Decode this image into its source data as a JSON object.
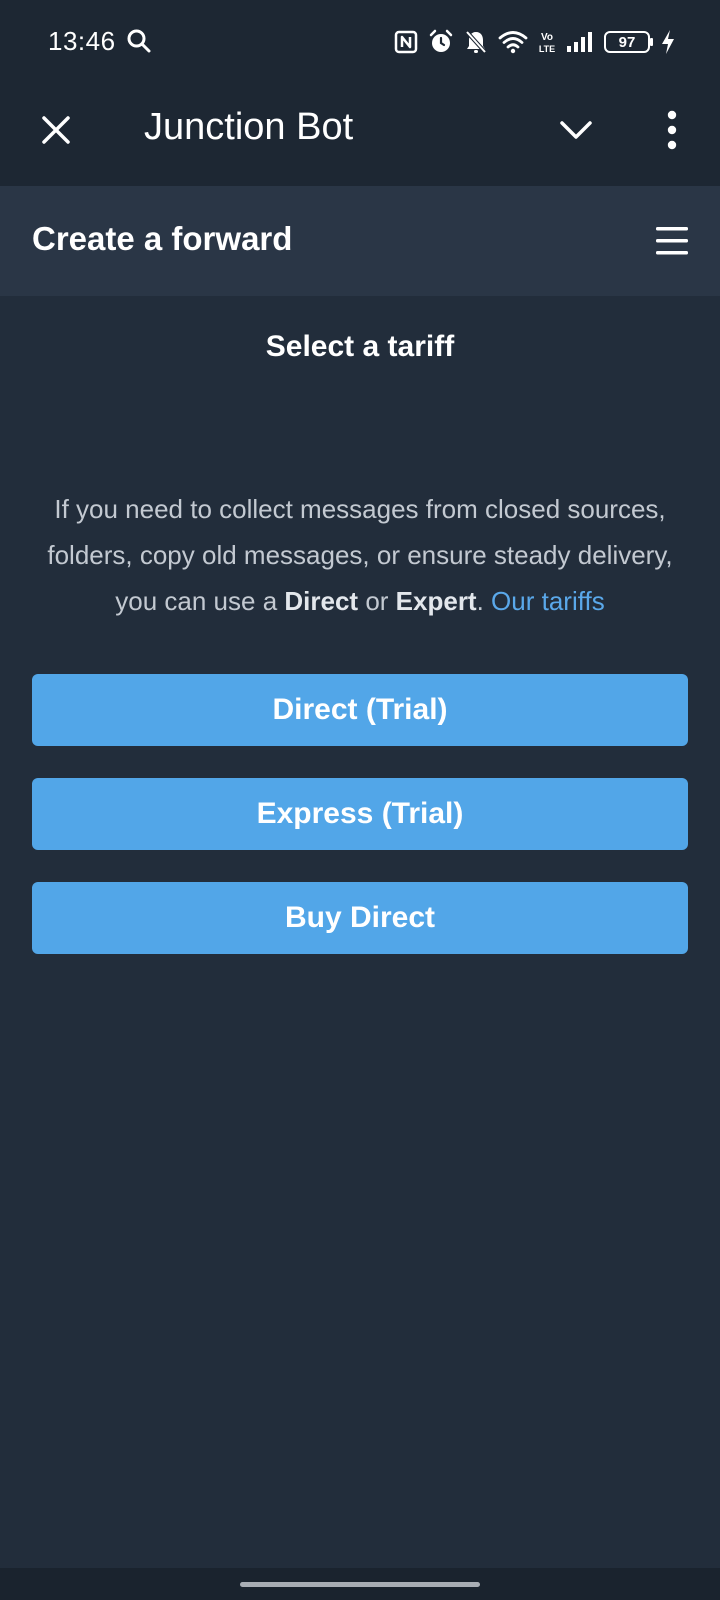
{
  "status_bar": {
    "time": "13:46",
    "battery_level": "97",
    "icons": [
      "search-icon",
      "nfc-icon",
      "alarm-icon",
      "bell-off-icon",
      "wifi-icon",
      "volte-icon",
      "signal-icon",
      "battery-icon",
      "charging-icon"
    ],
    "volte_label": "Vo LTE"
  },
  "app_bar": {
    "title": "Junction Bot"
  },
  "web_header": {
    "title": "Create a forward"
  },
  "main": {
    "section_title": "Select a tariff",
    "description": {
      "part1": "If you need to collect messages from closed sources, folders, copy old messages, or ensure steady delivery, you can use a ",
      "bold1": "Direct",
      "part2": " or ",
      "bold2": "Expert",
      "part3": ". ",
      "link": "Our tariffs"
    },
    "buttons": [
      {
        "label": "Direct (Trial)"
      },
      {
        "label": "Express (Trial)"
      },
      {
        "label": "Buy Direct"
      }
    ]
  },
  "colors": {
    "background": "#222d3b",
    "app_bar": "#1d2733",
    "header": "#2a3646",
    "button": "#52a6e8",
    "link": "#5aa8ea"
  }
}
